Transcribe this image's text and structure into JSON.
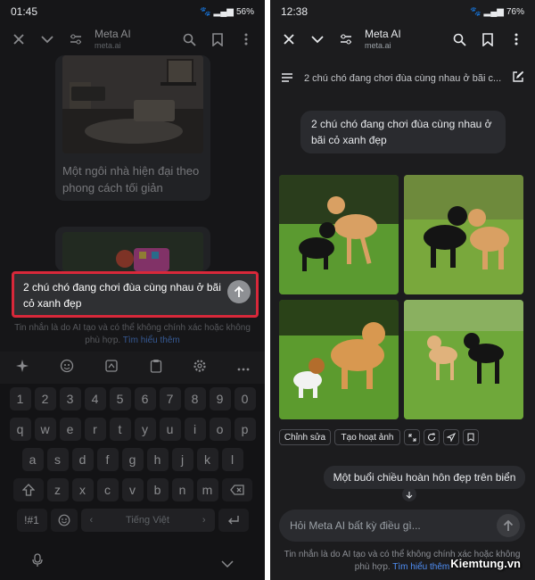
{
  "left": {
    "status": {
      "time": "01:45",
      "battery": "56%"
    },
    "topbar": {
      "title": "Meta AI",
      "url": "meta.ai"
    },
    "previous_caption": "Một ngôi nhà hiện đại theo phong cách tối giản",
    "prompt_text": "2 chú chó đang chơi đùa cùng nhau ở bãi cỏ xanh đẹp",
    "disclaimer": "Tin nhắn là do AI tạo và có thể không chính xác hoặc không phù hợp.",
    "disclaimer_link": "Tìm hiểu thêm",
    "keyboard": {
      "row1": [
        "1",
        "2",
        "3",
        "4",
        "5",
        "6",
        "7",
        "8",
        "9",
        "0"
      ],
      "row2": [
        "q",
        "w",
        "e",
        "r",
        "t",
        "y",
        "u",
        "i",
        "o",
        "p"
      ],
      "row3": [
        "a",
        "s",
        "d",
        "f",
        "g",
        "h",
        "j",
        "k",
        "l"
      ],
      "row4": [
        "z",
        "x",
        "c",
        "v",
        "b",
        "n",
        "m"
      ],
      "sym_key": "!#1",
      "space_label": "Tiếng Việt"
    }
  },
  "right": {
    "status": {
      "time": "12:38",
      "battery": "76%"
    },
    "topbar": {
      "title": "Meta AI",
      "url": "meta.ai"
    },
    "chat_title": "2 chú chó đang chơi đùa cùng nhau ở bãi c...",
    "user_message": "2 chú chó đang chơi đùa cùng nhau ở bãi cỏ xanh đẹp",
    "actions": {
      "edit": "Chỉnh sửa",
      "animate": "Tạo hoạt ảnh"
    },
    "suggestion": "Một buổi chiều hoàn hôn đẹp trên biển",
    "input_placeholder": "Hỏi Meta AI bất kỳ điều gì...",
    "disclaimer": "Tin nhắn là do AI tạo và có thể không chính xác hoặc không phù hợp.",
    "disclaimer_link": "Tìm hiểu thêm"
  },
  "watermark": "Kiemtung.vn",
  "colors": {
    "highlight": "#d8283a",
    "link": "#4f8ff7",
    "grass": "#4f8a2c"
  }
}
